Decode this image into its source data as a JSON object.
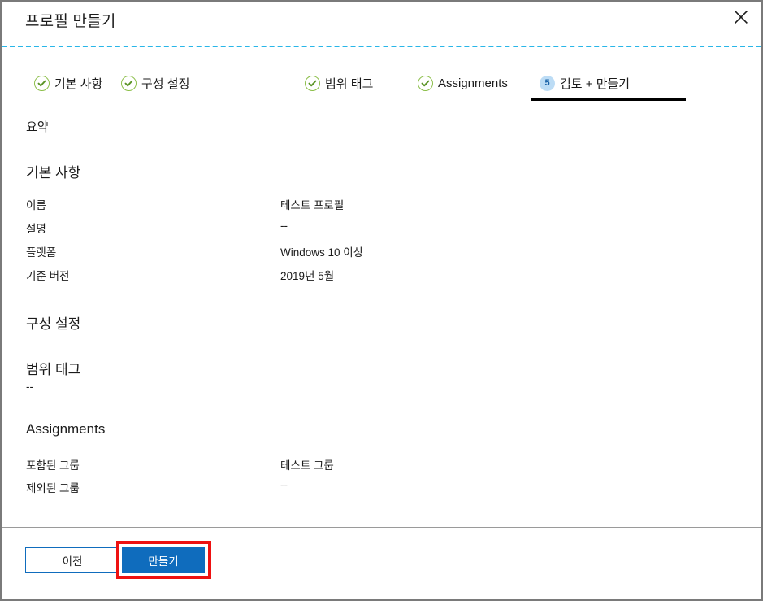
{
  "window": {
    "title": "프로필 만들기",
    "close_icon": "close-icon",
    "border_color": "#7a7a7a",
    "accent_color": "#0f6cbd",
    "divider_color": "#29b6e8",
    "highlight_color": "#ee1111"
  },
  "tabs": [
    {
      "label": "기본 사항",
      "state": "complete",
      "marker": "check"
    },
    {
      "label": "구성 설정",
      "state": "complete",
      "marker": "check"
    },
    {
      "label": "범위 태그",
      "state": "complete",
      "marker": "check"
    },
    {
      "label": "Assignments",
      "state": "complete",
      "marker": "check"
    },
    {
      "label": "검토 + 만들기",
      "state": "active",
      "marker": "5"
    }
  ],
  "content": {
    "summary_title": "요약",
    "sections": [
      {
        "heading": "기본 사항",
        "rows": [
          {
            "key": "이름",
            "value": "테스트 프로필"
          },
          {
            "key": "설명",
            "value": "--"
          },
          {
            "key": "플랫폼",
            "value": "Windows 10 이상"
          },
          {
            "key": "기준 버전",
            "value": "2019년 5월"
          }
        ]
      },
      {
        "heading": "구성 설정",
        "rows": []
      },
      {
        "heading": "범위 태그",
        "standalone_value": "--",
        "rows": []
      },
      {
        "heading": "Assignments",
        "rows": [
          {
            "key": "포함된 그룹",
            "value": "테스트 그룹"
          },
          {
            "key": "제외된 그룹",
            "value": "--"
          }
        ]
      }
    ]
  },
  "footer": {
    "back_label": "이전",
    "create_label": "만들기"
  }
}
